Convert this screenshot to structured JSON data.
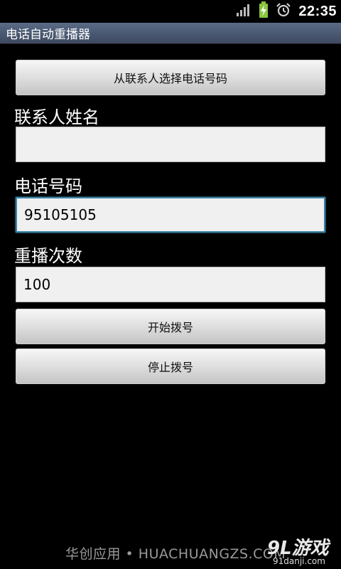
{
  "status_bar": {
    "time": "22:35"
  },
  "title_bar": {
    "title": "电话自动重播器"
  },
  "form": {
    "select_contact_button": "从联系人选择电话号码",
    "contact_name_label": "联系人姓名",
    "contact_name_value": "",
    "phone_label": "电话号码",
    "phone_value": "95105105",
    "redial_label": "重播次数",
    "redial_value": "100",
    "start_button": "开始拨号",
    "stop_button": "停止拨号"
  },
  "watermark": {
    "footer_text": "华创应用 • HUACHUANGZS.COM",
    "logo_main": "9L游戏",
    "logo_sub": "91danji.com"
  },
  "colors": {
    "background": "#000000",
    "titlebar": "#4a5773",
    "focus_border": "#3a86a8"
  }
}
